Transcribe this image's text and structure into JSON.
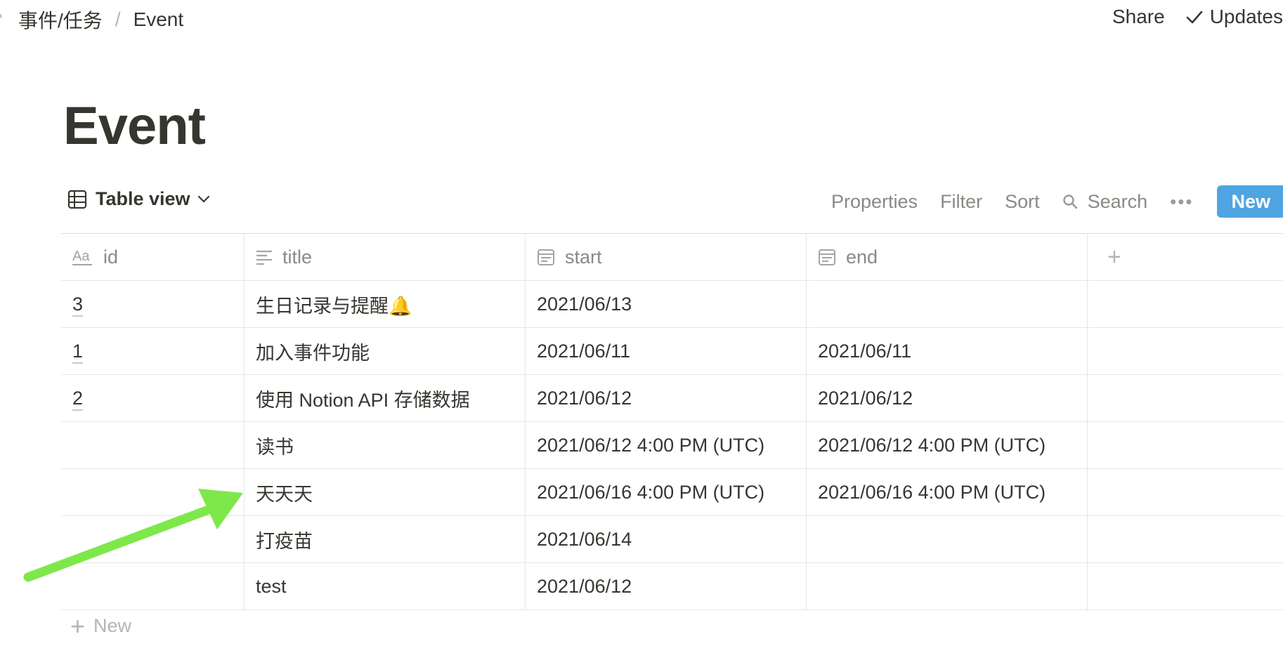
{
  "breadcrumb": {
    "parent": "事件/任务",
    "separator": "/",
    "current": "Event"
  },
  "topbar": {
    "share": "Share",
    "updates": "Updates"
  },
  "page": {
    "title": "Event"
  },
  "view": {
    "name": "Table view",
    "actions": {
      "properties": "Properties",
      "filter": "Filter",
      "sort": "Sort",
      "search": "Search",
      "more": "•••",
      "new": "New"
    }
  },
  "table": {
    "columns": [
      {
        "label": "id",
        "icon": "text-aa-icon"
      },
      {
        "label": "title",
        "icon": "text-lines-icon"
      },
      {
        "label": "start",
        "icon": "calendar-icon"
      },
      {
        "label": "end",
        "icon": "calendar-icon"
      }
    ],
    "add_column": "+",
    "rows": [
      {
        "id": "3",
        "title": "生日记录与提醒🔔",
        "start": "2021/06/13",
        "end": ""
      },
      {
        "id": "1",
        "title": "加入事件功能",
        "start": "2021/06/11",
        "end": "2021/06/11"
      },
      {
        "id": "2",
        "title": "使用 Notion API 存储数据",
        "start": "2021/06/12",
        "end": "2021/06/12"
      },
      {
        "id": "",
        "title": "读书",
        "start": "2021/06/12 4:00 PM (UTC)",
        "end": "2021/06/12 4:00 PM (UTC)"
      },
      {
        "id": "",
        "title": "天天天",
        "start": "2021/06/16 4:00 PM (UTC)",
        "end": "2021/06/16 4:00 PM (UTC)"
      },
      {
        "id": "",
        "title": "打疫苗",
        "start": "2021/06/14",
        "end": ""
      },
      {
        "id": "",
        "title": "test",
        "start": "2021/06/12",
        "end": ""
      }
    ],
    "add_row": "New"
  },
  "colors": {
    "accent": "#4fa5e1",
    "annotation_arrow": "#7ee84a",
    "text": "#37352f",
    "muted": "#8a8984"
  }
}
